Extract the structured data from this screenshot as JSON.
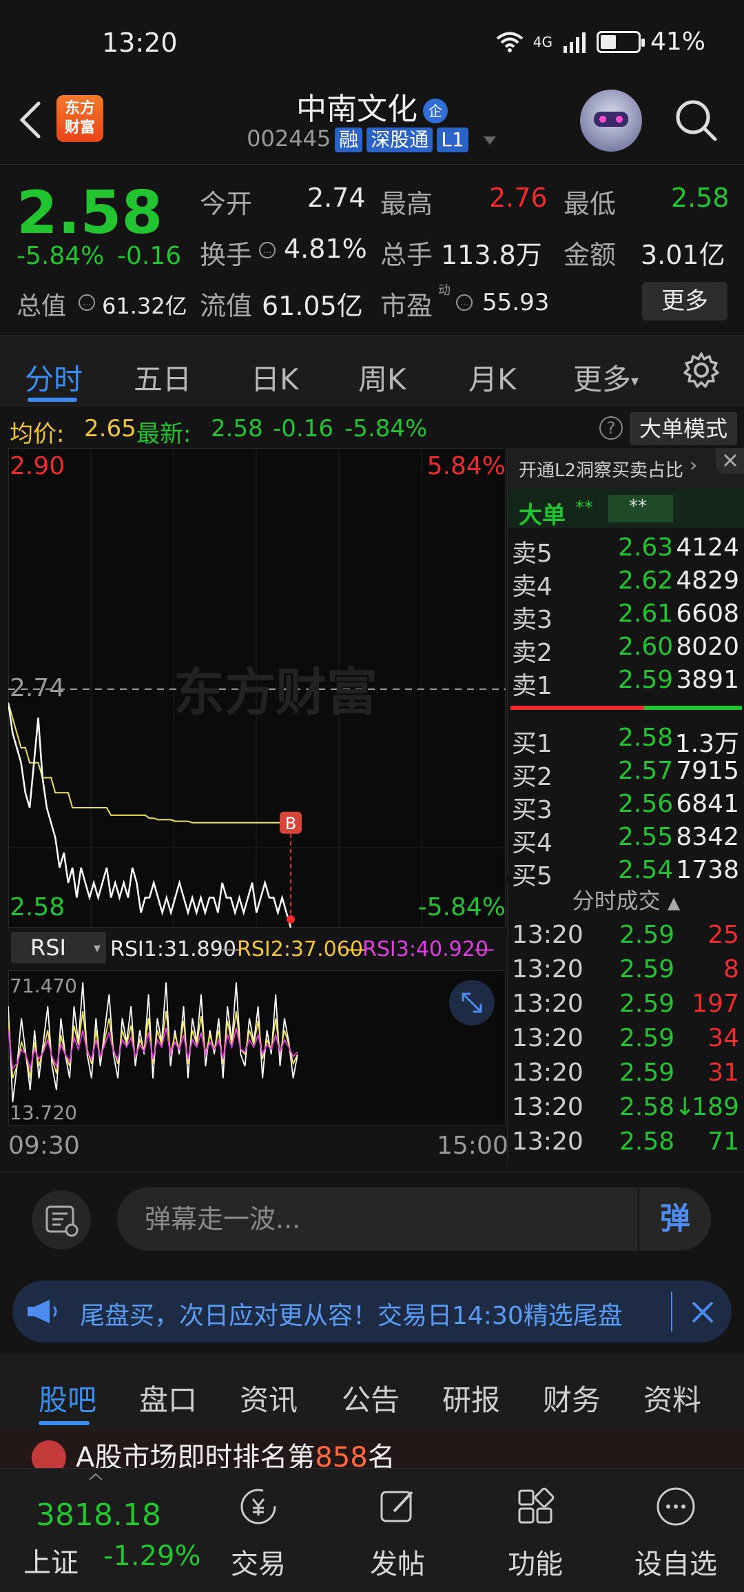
{
  "status_bar": {
    "time": "13:20",
    "network": "4G",
    "battery": "41%"
  },
  "header": {
    "logo_line1": "东方",
    "logo_line2": "财富",
    "title": "中南文化",
    "title_badge": "企",
    "code": "002445",
    "tags": [
      "融",
      "深股通",
      "L1"
    ]
  },
  "quote": {
    "price": "2.58",
    "change_pct": "-5.84%",
    "change": "-0.16",
    "open_label": "今开",
    "open": "2.74",
    "high_label": "最高",
    "high": "2.76",
    "low_label": "最低",
    "low": "2.58",
    "turnover_label": "换手",
    "turnover": "4.81%",
    "volume_label": "总手",
    "volume": "113.8万",
    "amount_label": "金额",
    "amount": "3.01亿",
    "mktcap_label": "总值",
    "mktcap": "61.32亿",
    "float_label": "流值",
    "float": "61.05亿",
    "pe_label": "市盈",
    "pe_sup": "动",
    "pe": "55.93",
    "more_button": "更多"
  },
  "chart_tabs": [
    "分时",
    "五日",
    "日K",
    "周K",
    "月K",
    "更多"
  ],
  "avg_bar": {
    "avg_label": "均价:",
    "avg": "2.65",
    "latest_label": "最新:",
    "latest": "2.58",
    "change": "-0.16",
    "change_pct": "-5.84%",
    "help": "?",
    "big_mode": "大单模式"
  },
  "chart": {
    "top_price": "2.90",
    "top_pct": "5.84%",
    "ref_price": "2.74",
    "bottom_price": "2.58",
    "bottom_pct": "-5.84%",
    "watermark": "东方财富",
    "marker": "B",
    "time_start": "09:30",
    "time_end": "15:00",
    "price_line": [
      2.73,
      2.71,
      2.7,
      2.69,
      2.67,
      2.66,
      2.69,
      2.72,
      2.68,
      2.66,
      2.65,
      2.64,
      2.62,
      2.63,
      2.61,
      2.62,
      2.6,
      2.62,
      2.61,
      2.6,
      2.61,
      2.6,
      2.61,
      2.62,
      2.6,
      2.61,
      2.6,
      2.61,
      2.6,
      2.62,
      2.61,
      2.59,
      2.6,
      2.6,
      2.61,
      2.6,
      2.59,
      2.6,
      2.59,
      2.6,
      2.61,
      2.6,
      2.59,
      2.6,
      2.59,
      2.6,
      2.59,
      2.6,
      2.6,
      2.59,
      2.61,
      2.6,
      2.6,
      2.59,
      2.6,
      2.59,
      2.6,
      2.61,
      2.59,
      2.6,
      2.61,
      2.6,
      2.6,
      2.59,
      2.6,
      2.59,
      2.58
    ],
    "avg_line": [
      2.73,
      2.72,
      2.71,
      2.7,
      2.7,
      2.69,
      2.69,
      2.69,
      2.68,
      2.68,
      2.68,
      2.67,
      2.67,
      2.67,
      2.67,
      2.66,
      2.66,
      2.66,
      2.66,
      2.66,
      2.66,
      2.66,
      2.66,
      2.66,
      2.655,
      2.655,
      2.655,
      2.655,
      2.655,
      2.655,
      2.655,
      2.655,
      2.655,
      2.653,
      2.653,
      2.652,
      2.652,
      2.652,
      2.652,
      2.651,
      2.651,
      2.651,
      2.651,
      2.65,
      2.65,
      2.65,
      2.65,
      2.65,
      2.65,
      2.65,
      2.65,
      2.65,
      2.65,
      2.65,
      2.65,
      2.65,
      2.65,
      2.65,
      2.65,
      2.65,
      2.65,
      2.65,
      2.65,
      2.65,
      2.65,
      2.65,
      2.65
    ]
  },
  "rsi": {
    "selector": "RSI",
    "rsi1": "RSI1:31.890",
    "rsi2": "RSI2:37.060",
    "rsi3": "RSI3:40.920",
    "max": "71.470",
    "min": "13.720",
    "rsi1_series": [
      60,
      20,
      35,
      55,
      40,
      25,
      50,
      30,
      45,
      60,
      35,
      25,
      55,
      40,
      30,
      60,
      45,
      70,
      40,
      30,
      55,
      35,
      50,
      65,
      40,
      30,
      55,
      45,
      60,
      35,
      50,
      40,
      65,
      30,
      55,
      45,
      70,
      35,
      50,
      40,
      60,
      30,
      55,
      45,
      65,
      35,
      50,
      40,
      55,
      30,
      60,
      45,
      70,
      40,
      35,
      55,
      45,
      60,
      30,
      50,
      40,
      65,
      35,
      55,
      45,
      30,
      40
    ],
    "rsi2_series": [
      55,
      30,
      35,
      45,
      40,
      30,
      45,
      35,
      42,
      50,
      38,
      32,
      48,
      40,
      35,
      52,
      44,
      58,
      42,
      36,
      50,
      38,
      46,
      55,
      42,
      36,
      50,
      44,
      52,
      38,
      46,
      42,
      55,
      36,
      50,
      44,
      58,
      40,
      48,
      42,
      54,
      36,
      50,
      44,
      56,
      40,
      48,
      42,
      50,
      36,
      54,
      44,
      58,
      42,
      40,
      50,
      44,
      54,
      38,
      46,
      42,
      55,
      40,
      50,
      44,
      36,
      40
    ],
    "rsi3_series": [
      50,
      34,
      36,
      42,
      40,
      34,
      42,
      38,
      41,
      46,
      39,
      35,
      44,
      40,
      37,
      47,
      42,
      50,
      41,
      38,
      46,
      39,
      44,
      49,
      41,
      38,
      46,
      43,
      47,
      39,
      44,
      41,
      49,
      38,
      46,
      43,
      51,
      40,
      45,
      42,
      48,
      38,
      46,
      43,
      49,
      40,
      45,
      42,
      46,
      38,
      48,
      43,
      51,
      42,
      41,
      46,
      43,
      48,
      40,
      44,
      42,
      48,
      41,
      46,
      43,
      39,
      41
    ]
  },
  "order_book": {
    "promo": "开通L2洞察买卖占比",
    "big_label": "大单",
    "stars1": "**",
    "stars2": "**",
    "asks": [
      {
        "name": "卖5",
        "price": "2.63",
        "vol": "4124"
      },
      {
        "name": "卖4",
        "price": "2.62",
        "vol": "4829"
      },
      {
        "name": "卖3",
        "price": "2.61",
        "vol": "6608"
      },
      {
        "name": "卖2",
        "price": "2.60",
        "vol": "8020"
      },
      {
        "name": "卖1",
        "price": "2.59",
        "vol": "3891"
      }
    ],
    "bids": [
      {
        "name": "买1",
        "price": "2.58",
        "vol": "1.3万"
      },
      {
        "name": "买2",
        "price": "2.57",
        "vol": "7915"
      },
      {
        "name": "买3",
        "price": "2.56",
        "vol": "6841"
      },
      {
        "name": "买4",
        "price": "2.55",
        "vol": "8342"
      },
      {
        "name": "买5",
        "price": "2.54",
        "vol": "1738"
      }
    ]
  },
  "ticks": {
    "title": "分时成交",
    "rows": [
      {
        "time": "13:20",
        "price": "2.59",
        "vol": "25"
      },
      {
        "time": "13:20",
        "price": "2.59",
        "vol": "8"
      },
      {
        "time": "13:20",
        "price": "2.59",
        "vol": "197"
      },
      {
        "time": "13:20",
        "price": "2.59",
        "vol": "34"
      },
      {
        "time": "13:20",
        "price": "2.59",
        "vol": "31"
      },
      {
        "time": "13:20",
        "price": "2.58↓",
        "vol": "189"
      },
      {
        "time": "13:20",
        "price": "2.58",
        "vol": "71"
      }
    ]
  },
  "danmu": {
    "placeholder": "弹幕走一波...",
    "button": "弹"
  },
  "banner": {
    "text": "尾盘买，次日应对更从容！交易日14:30精选尾盘"
  },
  "sub_tabs": [
    "股吧",
    "盘口",
    "资讯",
    "公告",
    "研报",
    "财务",
    "资料"
  ],
  "promo_strip": {
    "text": "A股市场即时排名第",
    "highlight": "858",
    "suffix": "名"
  },
  "bottom_nav": {
    "index_value": "3818.18",
    "index_name": "上证",
    "index_change": "-1.29%",
    "items": [
      "交易",
      "发帖",
      "功能",
      "设自选"
    ]
  },
  "colors": {
    "up": "#ef2b2b",
    "down": "#22c52f",
    "accent": "#3a8ef2",
    "avg_line": "#f2e15a"
  }
}
